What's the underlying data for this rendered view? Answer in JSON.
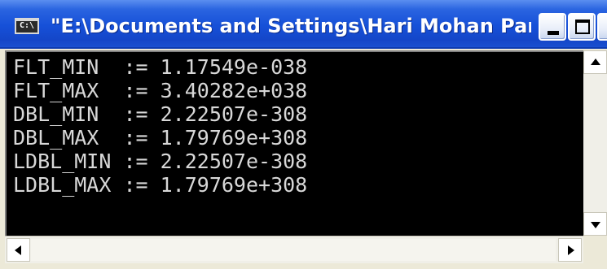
{
  "window": {
    "title": "\"E:\\Documents and Settings\\Hari Mohan Pan...",
    "icon_label": "C:\\",
    "icon": "console-icon",
    "buttons": {
      "minimize": "minimize-icon",
      "maximize": "maximize-icon",
      "close_glyph": "×"
    }
  },
  "console": {
    "lines": [
      "FLT_MIN  := 1.17549e-038",
      "FLT_MAX  := 3.40282e+038",
      "DBL_MIN  := 2.22507e-308",
      "DBL_MAX  := 1.79769e+308",
      "LDBL_MIN := 2.22507e-308",
      "LDBL_MAX := 1.79769e+308"
    ]
  },
  "colors": {
    "title_bar": "#1650d8",
    "console_bg": "#000000",
    "console_text": "#d8d8d8"
  }
}
